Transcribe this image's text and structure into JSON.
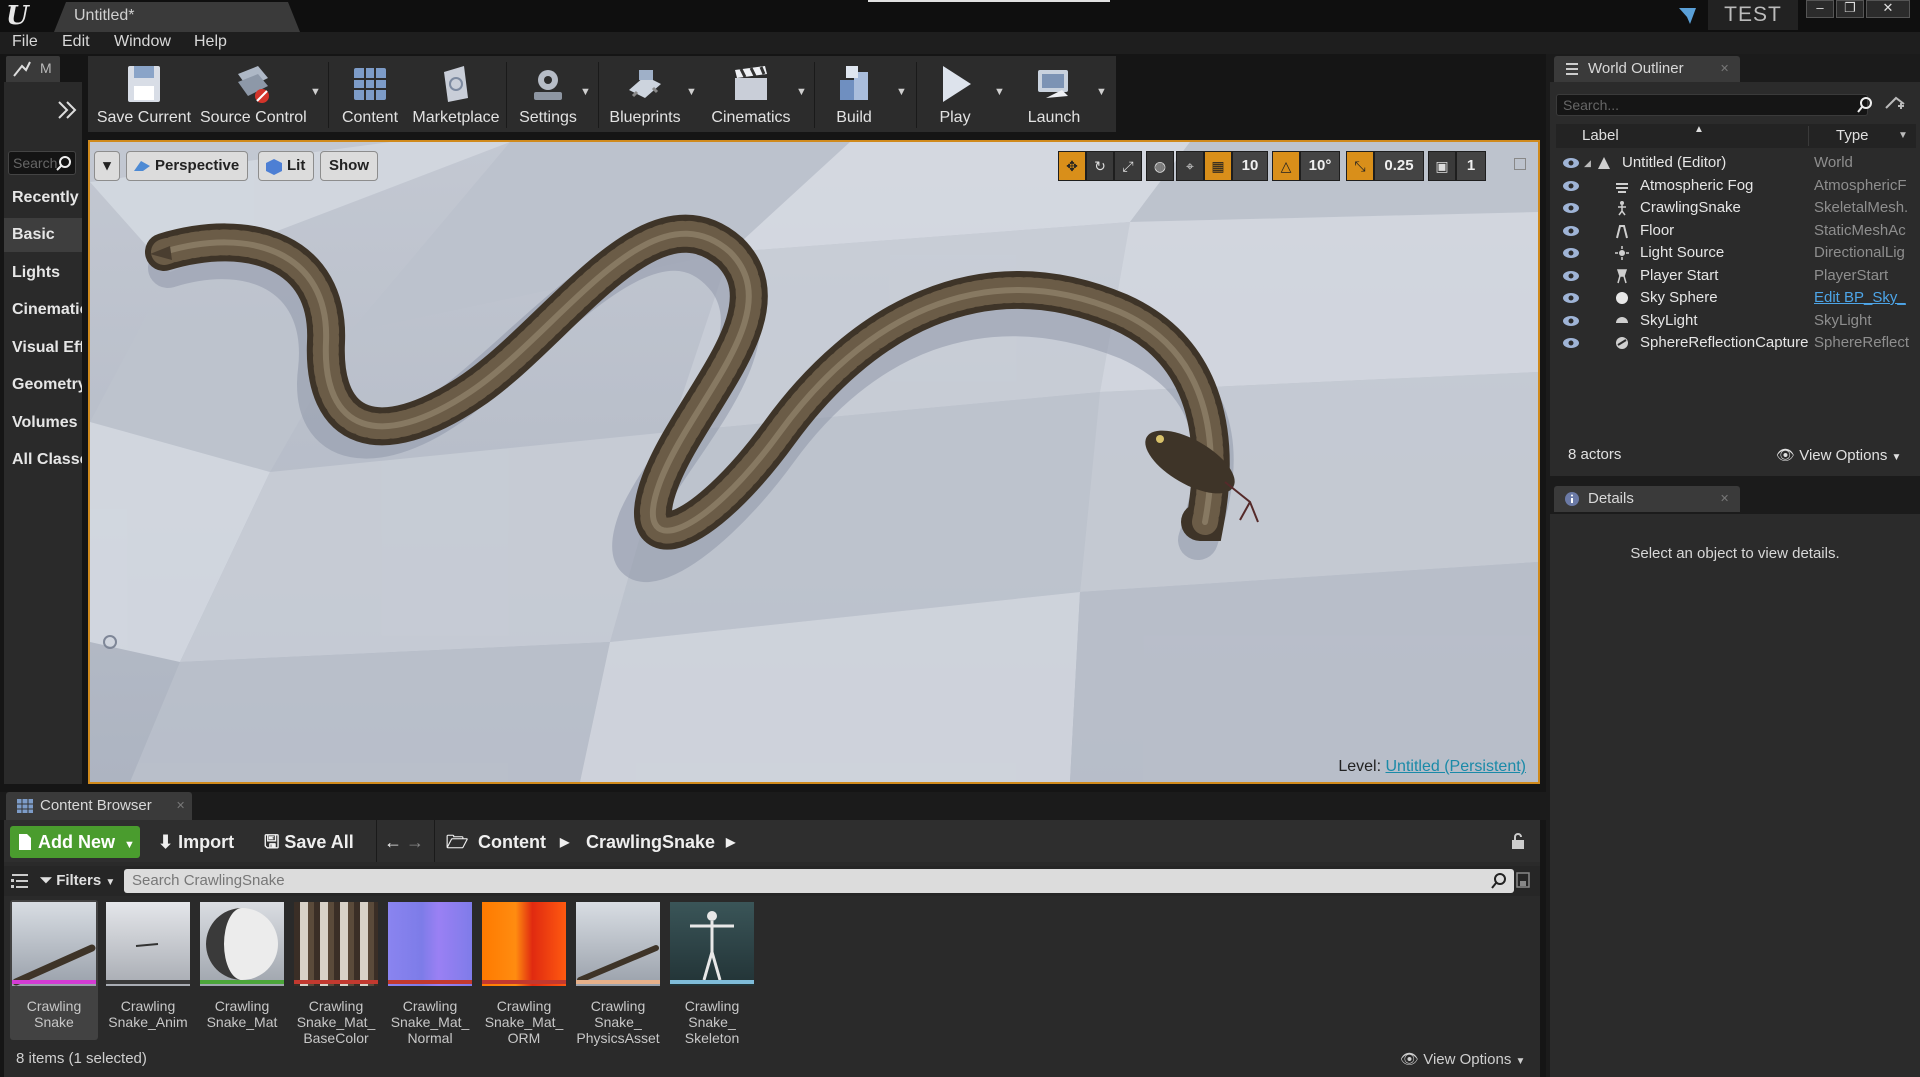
{
  "window": {
    "doc_tab": "Untitled*",
    "project": "TEST",
    "controls": {
      "minimize": "–",
      "restore": "❐",
      "close": "✕"
    }
  },
  "menu": [
    "File",
    "Edit",
    "Window",
    "Help"
  ],
  "modes": {
    "tab_label": "M",
    "search_placeholder": "Search",
    "categories": [
      "Recently",
      "Basic",
      "Lights",
      "Cinematic",
      "Visual Eff",
      "Geometry",
      "Volumes",
      "All Classe"
    ],
    "active": "Basic"
  },
  "toolbar": {
    "save_current": "Save Current",
    "source_control": "Source Control",
    "content": "Content",
    "marketplace": "Marketplace",
    "settings": "Settings",
    "blueprints": "Blueprints",
    "cinematics": "Cinematics",
    "build": "Build",
    "play": "Play",
    "launch": "Launch"
  },
  "viewport": {
    "perspective": "Perspective",
    "lit": "Lit",
    "show": "Show",
    "grid_snap": "10",
    "rotation_snap": "10°",
    "scale_snap": "0.25",
    "camera_speed": "1",
    "level_prefix": "Level:",
    "level_name": "Untitled (Persistent)"
  },
  "content_browser": {
    "tab_label": "Content Browser",
    "add_new": "Add New",
    "import": "Import",
    "save_all": "Save All",
    "breadcrumb": [
      "Content",
      "CrawlingSnake"
    ],
    "filters": "Filters",
    "search_placeholder": "Search CrawlingSnake",
    "assets": [
      {
        "name": "Crawling Snake",
        "bar_color": "#d43cd4",
        "selected": true
      },
      {
        "name": "Crawling Snake_Anim",
        "bar_color": "#3a3a3a",
        "selected": false
      },
      {
        "name": "Crawling Snake_Mat",
        "bar_color": "#4ca63a",
        "selected": false
      },
      {
        "name": "Crawling Snake_Mat_ BaseColor",
        "bar_color": "#c2392f",
        "selected": false
      },
      {
        "name": "Crawling Snake_Mat_ Normal",
        "bar_color": "#c2392f",
        "selected": false
      },
      {
        "name": "Crawling Snake_Mat_ ORM",
        "bar_color": "#c2392f",
        "selected": false
      },
      {
        "name": "Crawling Snake_ PhysicsAsset",
        "bar_color": "#e6b08a",
        "selected": false
      },
      {
        "name": "Crawling Snake_ Skeleton",
        "bar_color": "#7fbcd9",
        "selected": false
      }
    ],
    "status": "8 items (1 selected)",
    "view_options": "View Options"
  },
  "world_outliner": {
    "tab_label": "World Outliner",
    "search_placeholder": "Search...",
    "col_label": "Label",
    "col_type": "Type",
    "rows": [
      {
        "label": "Untitled (Editor)",
        "type": "World",
        "icon": "world-icon",
        "root": true
      },
      {
        "label": "Atmospheric Fog",
        "type": "AtmosphericF",
        "icon": "fog-icon"
      },
      {
        "label": "CrawlingSnake",
        "type": "SkeletalMesh.",
        "icon": "skeletal-mesh-icon"
      },
      {
        "label": "Floor",
        "type": "StaticMeshAc",
        "icon": "static-mesh-icon"
      },
      {
        "label": "Light Source",
        "type": "DirectionalLig",
        "icon": "directional-light-icon"
      },
      {
        "label": "Player Start",
        "type": "PlayerStart",
        "icon": "player-start-icon"
      },
      {
        "label": "Sky Sphere",
        "type": "Edit BP_Sky_",
        "icon": "sky-sphere-icon",
        "type_link": true
      },
      {
        "label": "SkyLight",
        "type": "SkyLight",
        "icon": "skylight-icon"
      },
      {
        "label": "SphereReflectionCapture",
        "type": "SphereReflect",
        "icon": "reflection-capture-icon"
      }
    ],
    "actor_count": "8 actors",
    "view_options": "View Options"
  },
  "details": {
    "tab_label": "Details",
    "empty_message": "Select an object to view details."
  },
  "colors": {
    "accent_orange": "#d08a1c",
    "add_new_green": "#4a9c2e",
    "link_blue": "#4da5e8"
  }
}
